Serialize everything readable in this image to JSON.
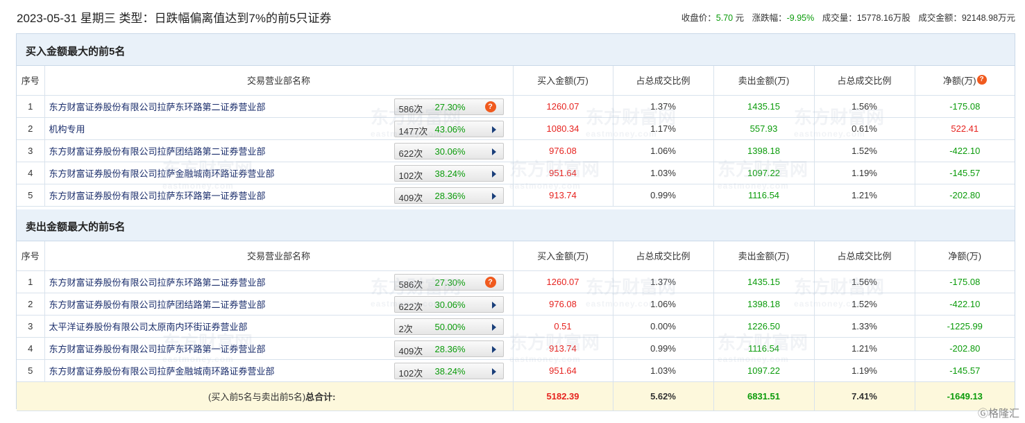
{
  "header": {
    "date": "2023-05-31",
    "weekday": "星期三",
    "type_label": "类型：",
    "type_value": "日跌幅偏离值达到7%的前5只证券",
    "close_label": "收盘价：",
    "close_value": "5.70",
    "close_unit": "元",
    "change_label": "涨跌幅：",
    "change_value": "-9.95%",
    "volume_label": "成交量：",
    "volume_value": "15778.16万股",
    "amount_label": "成交金额：",
    "amount_value": "92148.98万元"
  },
  "columns": {
    "idx": "序号",
    "name": "交易营业部名称",
    "buy": "买入金额(万)",
    "buy_ratio": "占总成交比例",
    "sell": "卖出金额(万)",
    "sell_ratio": "占总成交比例",
    "net": "净额(万)"
  },
  "buy_section": {
    "title": "买入金额最大的前5名",
    "rows": [
      {
        "idx": "1",
        "name": "东方财富证券股份有限公司拉萨东环路第二证券营业部",
        "count": "586次",
        "pct": "27.30%",
        "icon": "question-icon",
        "buy": "1260.07",
        "buy_ratio": "1.37%",
        "sell": "1435.15",
        "sell_ratio": "1.56%",
        "net": "-175.08",
        "net_color": "green"
      },
      {
        "idx": "2",
        "name": "机构专用",
        "count": "1477次",
        "pct": "43.06%",
        "icon": "arrow-icon",
        "buy": "1080.34",
        "buy_ratio": "1.17%",
        "sell": "557.93",
        "sell_ratio": "0.61%",
        "net": "522.41",
        "net_color": "red"
      },
      {
        "idx": "3",
        "name": "东方财富证券股份有限公司拉萨团结路第二证券营业部",
        "count": "622次",
        "pct": "30.06%",
        "icon": "arrow-icon",
        "buy": "976.08",
        "buy_ratio": "1.06%",
        "sell": "1398.18",
        "sell_ratio": "1.52%",
        "net": "-422.10",
        "net_color": "green"
      },
      {
        "idx": "4",
        "name": "东方财富证券股份有限公司拉萨金融城南环路证券营业部",
        "count": "102次",
        "pct": "38.24%",
        "icon": "arrow-icon",
        "buy": "951.64",
        "buy_ratio": "1.03%",
        "sell": "1097.22",
        "sell_ratio": "1.19%",
        "net": "-145.57",
        "net_color": "green"
      },
      {
        "idx": "5",
        "name": "东方财富证券股份有限公司拉萨东环路第一证券营业部",
        "count": "409次",
        "pct": "28.36%",
        "icon": "arrow-icon",
        "buy": "913.74",
        "buy_ratio": "0.99%",
        "sell": "1116.54",
        "sell_ratio": "1.21%",
        "net": "-202.80",
        "net_color": "green"
      }
    ]
  },
  "sell_section": {
    "title": "卖出金额最大的前5名",
    "rows": [
      {
        "idx": "1",
        "name": "东方财富证券股份有限公司拉萨东环路第二证券营业部",
        "count": "586次",
        "pct": "27.30%",
        "icon": "question-icon",
        "buy": "1260.07",
        "buy_ratio": "1.37%",
        "sell": "1435.15",
        "sell_ratio": "1.56%",
        "net": "-175.08",
        "net_color": "green"
      },
      {
        "idx": "2",
        "name": "东方财富证券股份有限公司拉萨团结路第二证券营业部",
        "count": "622次",
        "pct": "30.06%",
        "icon": "arrow-icon",
        "buy": "976.08",
        "buy_ratio": "1.06%",
        "sell": "1398.18",
        "sell_ratio": "1.52%",
        "net": "-422.10",
        "net_color": "green"
      },
      {
        "idx": "3",
        "name": "太平洋证券股份有限公司太原南内环街证券营业部",
        "count": "2次",
        "pct": "50.00%",
        "icon": "arrow-icon",
        "buy": "0.51",
        "buy_ratio": "0.00%",
        "sell": "1226.50",
        "sell_ratio": "1.33%",
        "net": "-1225.99",
        "net_color": "green"
      },
      {
        "idx": "4",
        "name": "东方财富证券股份有限公司拉萨东环路第一证券营业部",
        "count": "409次",
        "pct": "28.36%",
        "icon": "arrow-icon",
        "buy": "913.74",
        "buy_ratio": "0.99%",
        "sell": "1116.54",
        "sell_ratio": "1.21%",
        "net": "-202.80",
        "net_color": "green"
      },
      {
        "idx": "5",
        "name": "东方财富证券股份有限公司拉萨金融城南环路证券营业部",
        "count": "102次",
        "pct": "38.24%",
        "icon": "arrow-icon",
        "buy": "951.64",
        "buy_ratio": "1.03%",
        "sell": "1097.22",
        "sell_ratio": "1.19%",
        "net": "-145.57",
        "net_color": "green"
      }
    ],
    "total": {
      "label_prefix": "(买入前5名与卖出前5名)",
      "label_suffix": "总合计:",
      "buy": "5182.39",
      "buy_ratio": "5.62%",
      "sell": "6831.51",
      "sell_ratio": "7.41%",
      "net": "-1649.13"
    }
  },
  "watermark": {
    "cn": "东方财富网",
    "en": "eastmoney.com"
  },
  "corner_brand": "Ⓖ格隆汇",
  "colors": {
    "red": "#e6231f",
    "green": "#0a9b0a",
    "header_bg": "#e9f1f9",
    "total_bg": "#fdf8dc",
    "orange": "#f05a1e"
  }
}
